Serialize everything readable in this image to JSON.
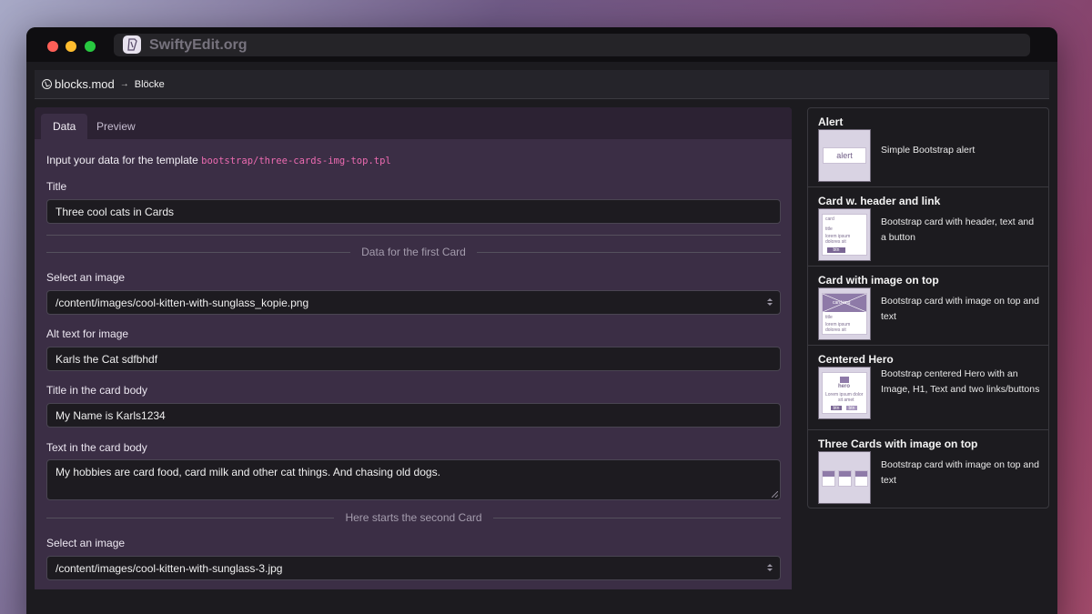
{
  "browser": {
    "url": "SwiftyEdit.org",
    "logo_icon": "swiftyedit-logo-icon"
  },
  "breadcrumb": {
    "root": "blocks.mod",
    "separator": "→",
    "current": "Blöcke"
  },
  "tabs": [
    {
      "label": "Data",
      "active": true
    },
    {
      "label": "Preview",
      "active": false
    }
  ],
  "form": {
    "intro_text": "Input your data for the template",
    "template_path": "bootstrap/three-cards-img-top.tpl",
    "title_label": "Title",
    "title_value": "Three cool cats in Cards",
    "section1": "Data for the first Card",
    "image1_label": "Select an image",
    "image1_value": "/content/images/cool-kitten-with-sunglass_kopie.png",
    "alt_label": "Alt text for image",
    "alt_value": "Karls the Cat sdfbhdf",
    "card_title_label": "Title in the card body",
    "card_title_value": "My Name is Karls1234",
    "card_text_label": "Text in the card body",
    "card_text_value": "My hobbies are card food, card milk and other cat things. And chasing old dogs.",
    "section2": "Here starts the second Card",
    "image2_label": "Select an image",
    "image2_value": "/content/images/cool-kitten-with-sunglass-3.jpg"
  },
  "blocks": [
    {
      "title": "Alert",
      "desc": "Simple Bootstrap alert",
      "thumb_text": [
        "alert"
      ]
    },
    {
      "title": "Card w. header and link",
      "desc": "Bootstrap card with header, text and a button",
      "thumb_text": [
        "card",
        "title",
        "lorem ipsum",
        "dolores sit",
        "btn"
      ]
    },
    {
      "title": "Card with image on top",
      "desc": "Bootstrap card with image on top and text",
      "thumb_text": [
        "card-img",
        "title",
        "lorem ipsum",
        "dolores sit"
      ]
    },
    {
      "title": "Centered Hero",
      "desc": "Bootstrap centered Hero with an Image, H1, Text and two links/buttons",
      "thumb_text": [
        "hero",
        "Lorem ipsum dolor",
        "sit amet",
        "btn",
        "btn"
      ]
    },
    {
      "title": "Three Cards with image on top",
      "desc": "Bootstrap card with image on top and text",
      "thumb_text": []
    }
  ],
  "colors": {
    "panel": "#3b2e45",
    "accent_code": "#ec6bb1",
    "window": "#1c1b1f"
  }
}
